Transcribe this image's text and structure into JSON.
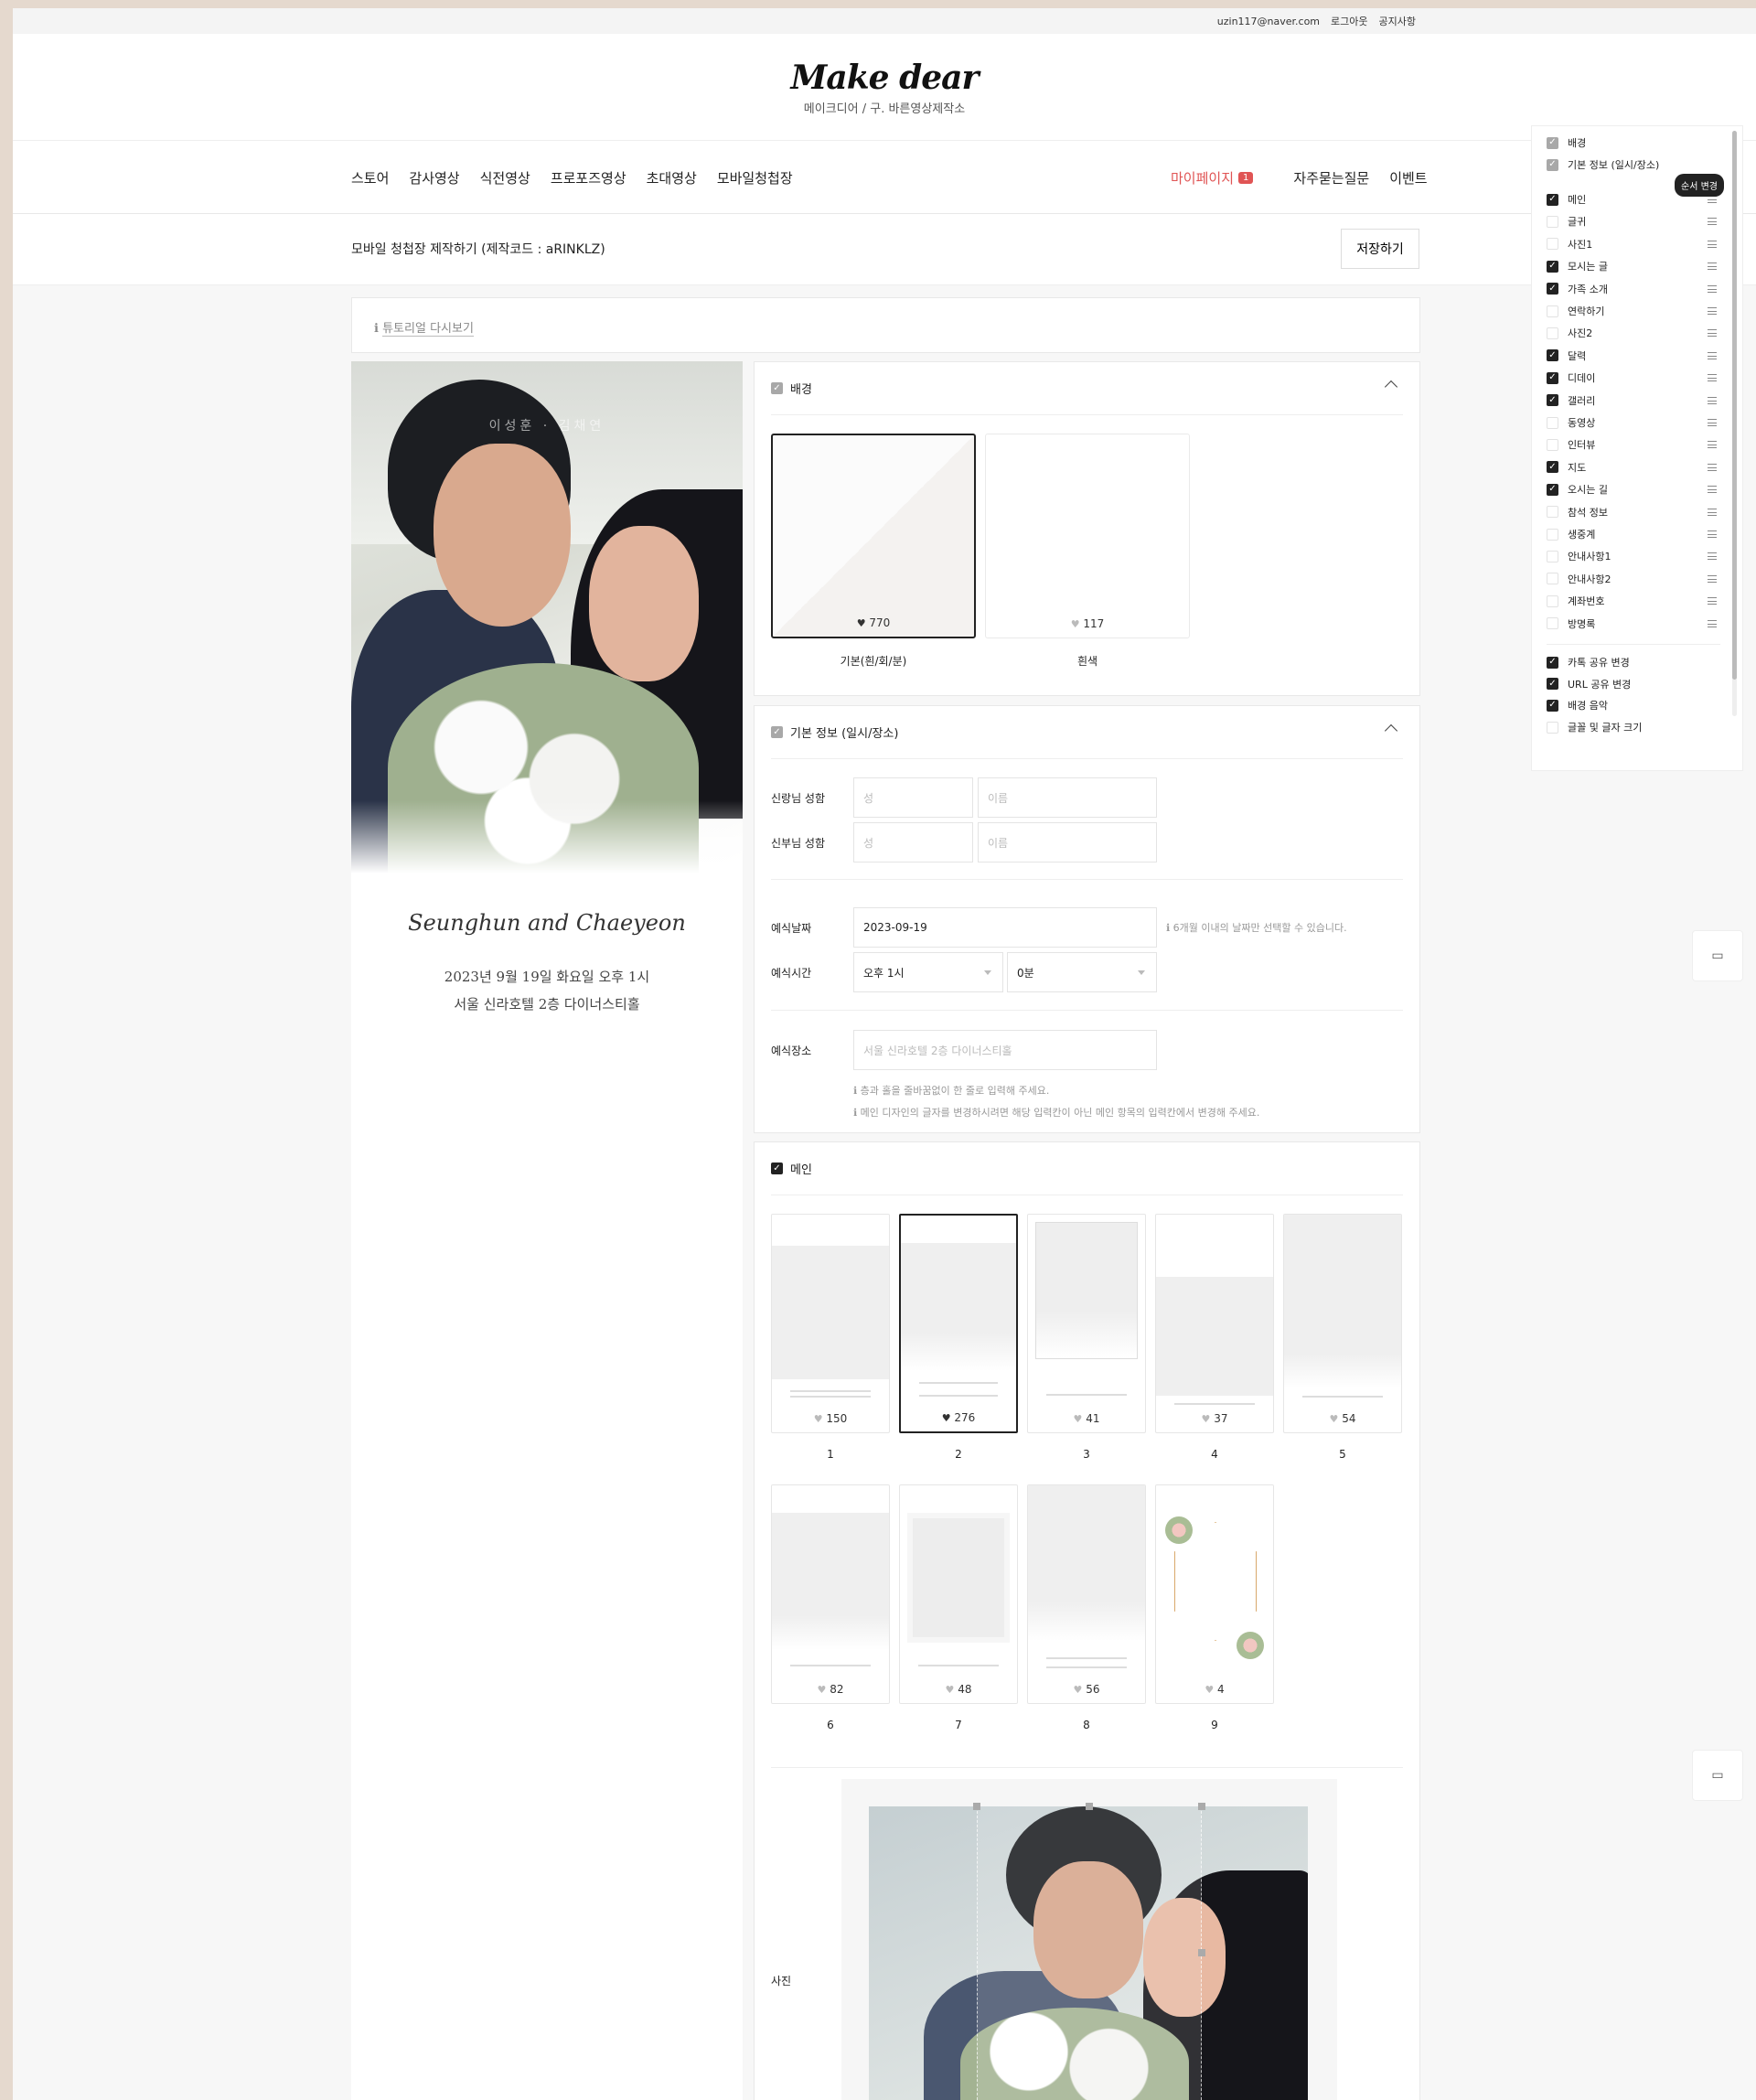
{
  "topbar": {
    "email": "uzin117@naver.com",
    "logout": "로그아웃",
    "notice": "공지사항"
  },
  "header": {
    "logo": "Make dear",
    "subtitle": "메이크디어 / 구. 바른영상제작소"
  },
  "nav": {
    "left": [
      "스토어",
      "감사영상",
      "식전영상",
      "프로포즈영상",
      "초대영상",
      "모바일청첩장"
    ],
    "mypage": "마이페이지",
    "mypage_badge": "1",
    "faq": "자주묻는질문",
    "event": "이벤트"
  },
  "subhead": {
    "title": "모바일 청첩장 제작하기 (제작코드 : aRINKLZ)",
    "save": "저장하기"
  },
  "tutorial": {
    "icon": "ℹ",
    "label": "튜토리얼 다시보기"
  },
  "preview": {
    "names": "이성훈 · 김채연",
    "script": "Seunghun and Chaeyeon",
    "date_line": "2023년 9월 19일 화요일 오후 1시",
    "place_line": "서울 신라호텔 2층 다이너스티홀"
  },
  "background_panel": {
    "title": "배경",
    "cards": [
      {
        "likes": "770",
        "label": "기본(흰/회/분)",
        "selected": true
      },
      {
        "likes": "117",
        "label": "흰색",
        "selected": false
      }
    ]
  },
  "basic_panel": {
    "title": "기본 정보 (일시/장소)",
    "groom_label": "신랑님 성함",
    "bride_label": "신부님 성함",
    "last_name_ph": "성",
    "first_name_ph": "이름",
    "date_label": "예식날짜",
    "date_value": "2023-09-19",
    "date_hint": "ℹ 6개월 이내의 날짜만 선택할 수 있습니다.",
    "time_label": "예식시간",
    "hour_value": "오후 1시",
    "minute_value": "0분",
    "place_label": "예식장소",
    "place_ph": "서울 신라호텔 2층 다이너스티홀",
    "hint1": "ℹ 층과 홀을 줄바꿈없이 한 줄로 입력해 주세요.",
    "hint2": "ℹ 메인 디자인의 글자를 변경하시려면 해당 입력칸이 아닌 메인 항목의 입력칸에서 변경해 주세요."
  },
  "main_panel": {
    "title": "메인",
    "designs": [
      {
        "num": "1",
        "likes": "150"
      },
      {
        "num": "2",
        "likes": "276"
      },
      {
        "num": "3",
        "likes": "41"
      },
      {
        "num": "4",
        "likes": "37"
      },
      {
        "num": "5",
        "likes": "54"
      },
      {
        "num": "6",
        "likes": "82"
      },
      {
        "num": "7",
        "likes": "48"
      },
      {
        "num": "8",
        "likes": "56"
      },
      {
        "num": "9",
        "likes": "4"
      }
    ],
    "selected": 2,
    "photo_label": "사진"
  },
  "sidebar": {
    "tooltip": "순서 변경",
    "items": [
      {
        "label": "배경",
        "state": "fixed"
      },
      {
        "label": "기본 정보 (일시/장소)",
        "state": "fixed"
      },
      {
        "label": "메인",
        "state": "on"
      },
      {
        "label": "글귀",
        "state": "off"
      },
      {
        "label": "사진1",
        "state": "off"
      },
      {
        "label": "모시는 글",
        "state": "on"
      },
      {
        "label": "가족 소개",
        "state": "on"
      },
      {
        "label": "연락하기",
        "state": "off"
      },
      {
        "label": "사진2",
        "state": "off"
      },
      {
        "label": "달력",
        "state": "on"
      },
      {
        "label": "디데이",
        "state": "on"
      },
      {
        "label": "갤러리",
        "state": "on"
      },
      {
        "label": "동영상",
        "state": "off"
      },
      {
        "label": "인터뷰",
        "state": "off"
      },
      {
        "label": "지도",
        "state": "on"
      },
      {
        "label": "오시는 길",
        "state": "on"
      },
      {
        "label": "참석 정보",
        "state": "off"
      },
      {
        "label": "생중계",
        "state": "off"
      },
      {
        "label": "안내사항1",
        "state": "off"
      },
      {
        "label": "안내사항2",
        "state": "off"
      },
      {
        "label": "계좌번호",
        "state": "off"
      },
      {
        "label": "방명록",
        "state": "off"
      }
    ],
    "options": [
      {
        "label": "카톡 공유 변경",
        "state": "on"
      },
      {
        "label": "URL 공유 변경",
        "state": "on"
      },
      {
        "label": "배경 음악",
        "state": "on"
      },
      {
        "label": "글꼴 및 글자 크기",
        "state": "off"
      }
    ]
  },
  "colors": {
    "accent": "#e05454",
    "selected_border": "#222222"
  },
  "icons": {
    "chat": "chat-bubble-icon",
    "heart": "heart-icon",
    "drag": "drag-handle-icon"
  }
}
